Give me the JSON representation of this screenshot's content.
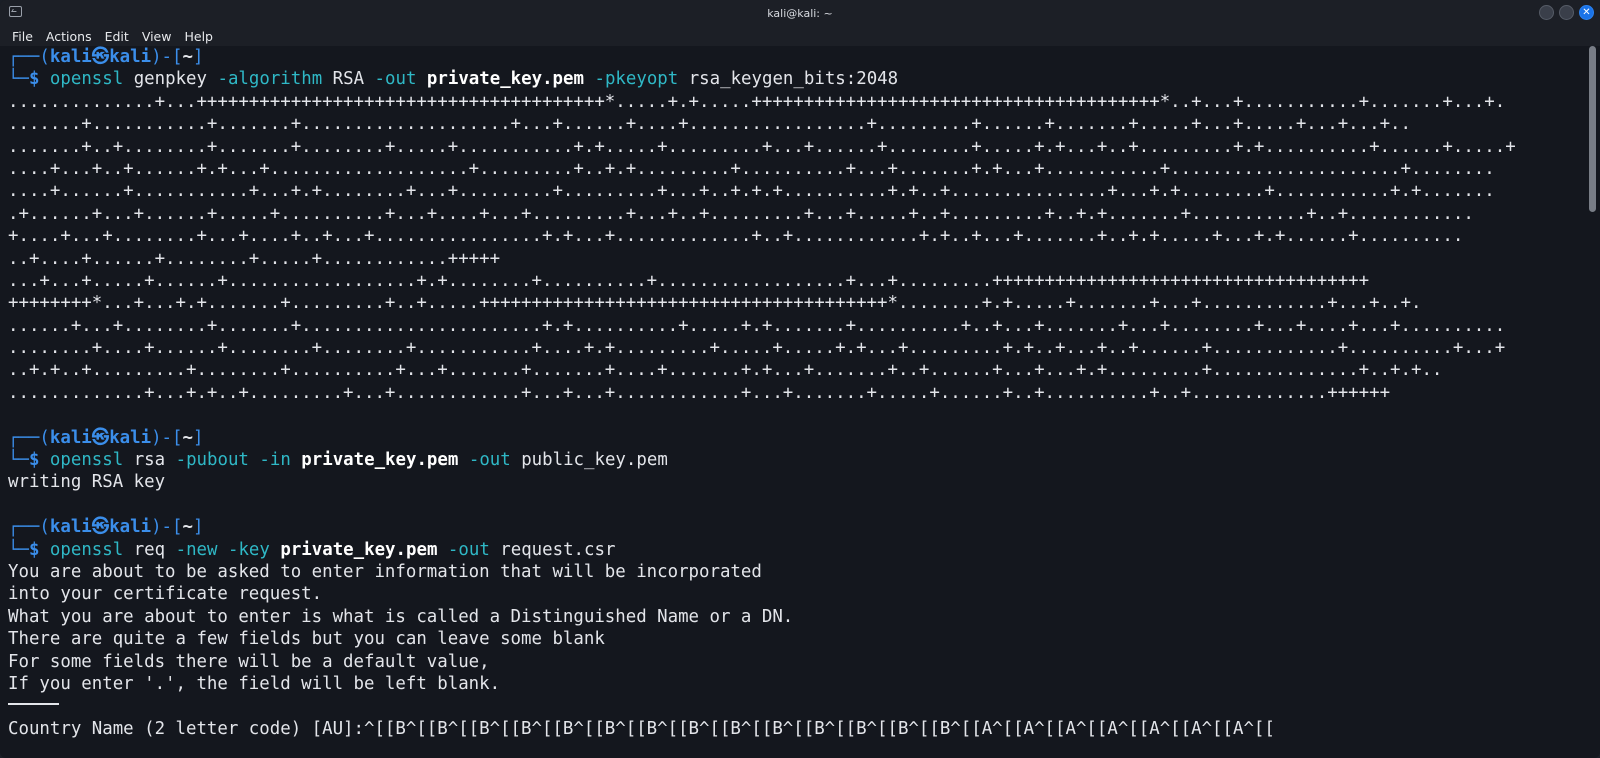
{
  "window": {
    "title": "kali@kali: ~",
    "menu": [
      "File",
      "Actions",
      "Edit",
      "View",
      "Help"
    ]
  },
  "colors": {
    "background": "#14171e",
    "prompt_blue": "#3b8eea",
    "command_cyan": "#2fb8c6",
    "text": "#e3e5ea",
    "close_button": "#1a73e8"
  },
  "prompt": {
    "user": "kali",
    "host": "kali",
    "dir": "~",
    "dollar": "$"
  },
  "commands": [
    {
      "tokens": [
        {
          "t": "openssl",
          "s": "cmd"
        },
        {
          "t": " ",
          "s": "arg"
        },
        {
          "t": "genpkey",
          "s": "arg"
        },
        {
          "t": " ",
          "s": "arg"
        },
        {
          "t": "-algorithm",
          "s": "opt"
        },
        {
          "t": " RSA ",
          "s": "arg"
        },
        {
          "t": "-out",
          "s": "opt"
        },
        {
          "t": " ",
          "s": "arg"
        },
        {
          "t": "private_key.pem",
          "s": "arg-b"
        },
        {
          "t": " ",
          "s": "arg"
        },
        {
          "t": "-pkeyopt",
          "s": "opt"
        },
        {
          "t": " rsa_keygen_bits:2048",
          "s": "arg"
        }
      ],
      "output": [
        "..............+...+++++++++++++++++++++++++++++++++++++++*.....+.+.....+++++++++++++++++++++++++++++++++++++++*..+...+...........+.......+...+.",
        ".......+...........+.......+....................+...+......+....+.................+.........+......+.......+.....+...+.....+...+...+..",
        ".......+..+........+.......+........+.....+...........+.+.....+.........+...+......+........+.....+.+...+..+.........+.+..........+......+.....+",
        "....+...+..+......+.+...+...................+.........+..+.+.........+..........+...+.......+.+...+...........+......................+........",
        "....+......+...........+...+.+........+...+.........+.........+...+..+.+.+..........+.+..+...............+...+.+........+...........+.+.......",
        ".+......+...+......+.....+..........+...+....+...+.........+...+..+.........+...+.....+..+.........+..+.+.......+...........+..+............",
        "+....+...+........+...+....+..+...+................+.+...+.............+..+............+.+..+...+.......+..+.+.....+...+.+......+..........",
        "..+....+......+........+.....+............+++++",
        "...+...+.....+......+..................+.+........+..........+..................+...+.........++++++++++++++++++++++++++++++++++++",
        "++++++++*...+...+.+.......+.........+..+.....+++++++++++++++++++++++++++++++++++++++*........+.+.....+.......+...+............+...+..+.",
        "......+...+........+.......+.......................+.+..........+.....+.+.......+..........+..+...+.......+...+........+...+....+...+..........",
        "........+....+......+........+........+...........+....+.+.........+.....+.....+.+...+.........+.+..+...+..+......+............+..........+...+",
        "..+.+..+.........+........+..........+...+.......+.......+....+.......+.+...+.......+..+......+...+...+.+.........+..............+..+.+..",
        ".............+...+.+..+.........+...+............+...+...+............+...+.......+.....+......+..+..........+..+.............++++++"
      ]
    },
    {
      "tokens": [
        {
          "t": "openssl",
          "s": "cmd"
        },
        {
          "t": " ",
          "s": "arg"
        },
        {
          "t": "rsa",
          "s": "arg"
        },
        {
          "t": " ",
          "s": "arg"
        },
        {
          "t": "-pubout",
          "s": "opt"
        },
        {
          "t": " ",
          "s": "arg"
        },
        {
          "t": "-in",
          "s": "opt"
        },
        {
          "t": " ",
          "s": "arg"
        },
        {
          "t": "private_key.pem",
          "s": "arg-b"
        },
        {
          "t": " ",
          "s": "arg"
        },
        {
          "t": "-out",
          "s": "opt"
        },
        {
          "t": " public_key.pem",
          "s": "arg"
        }
      ],
      "output": [
        "writing RSA key"
      ]
    },
    {
      "tokens": [
        {
          "t": "openssl",
          "s": "cmd"
        },
        {
          "t": " ",
          "s": "arg"
        },
        {
          "t": "req",
          "s": "arg"
        },
        {
          "t": " ",
          "s": "arg"
        },
        {
          "t": "-new",
          "s": "opt"
        },
        {
          "t": " ",
          "s": "arg"
        },
        {
          "t": "-key",
          "s": "opt"
        },
        {
          "t": " ",
          "s": "arg"
        },
        {
          "t": "private_key.pem",
          "s": "arg-b"
        },
        {
          "t": " ",
          "s": "arg"
        },
        {
          "t": "-out",
          "s": "opt"
        },
        {
          "t": " request.csr",
          "s": "arg"
        }
      ],
      "output": [
        "You are about to be asked to enter information that will be incorporated",
        "into your certificate request.",
        "What you are about to enter is what is called a Distinguished Name or a DN.",
        "There are quite a few fields but you can leave some blank",
        "For some fields there will be a default value,",
        "If you enter '.', the field will be left blank."
      ],
      "separator": true,
      "after": [
        "Country Name (2 letter code) [AU]:^[[B^[[B^[[B^[[B^[[B^[[B^[[B^[[B^[[B^[[B^[[B^[[B^[[B^[[B^[[A^[[A^[[A^[[A^[[A^[[A^[[A^[["
      ]
    }
  ]
}
